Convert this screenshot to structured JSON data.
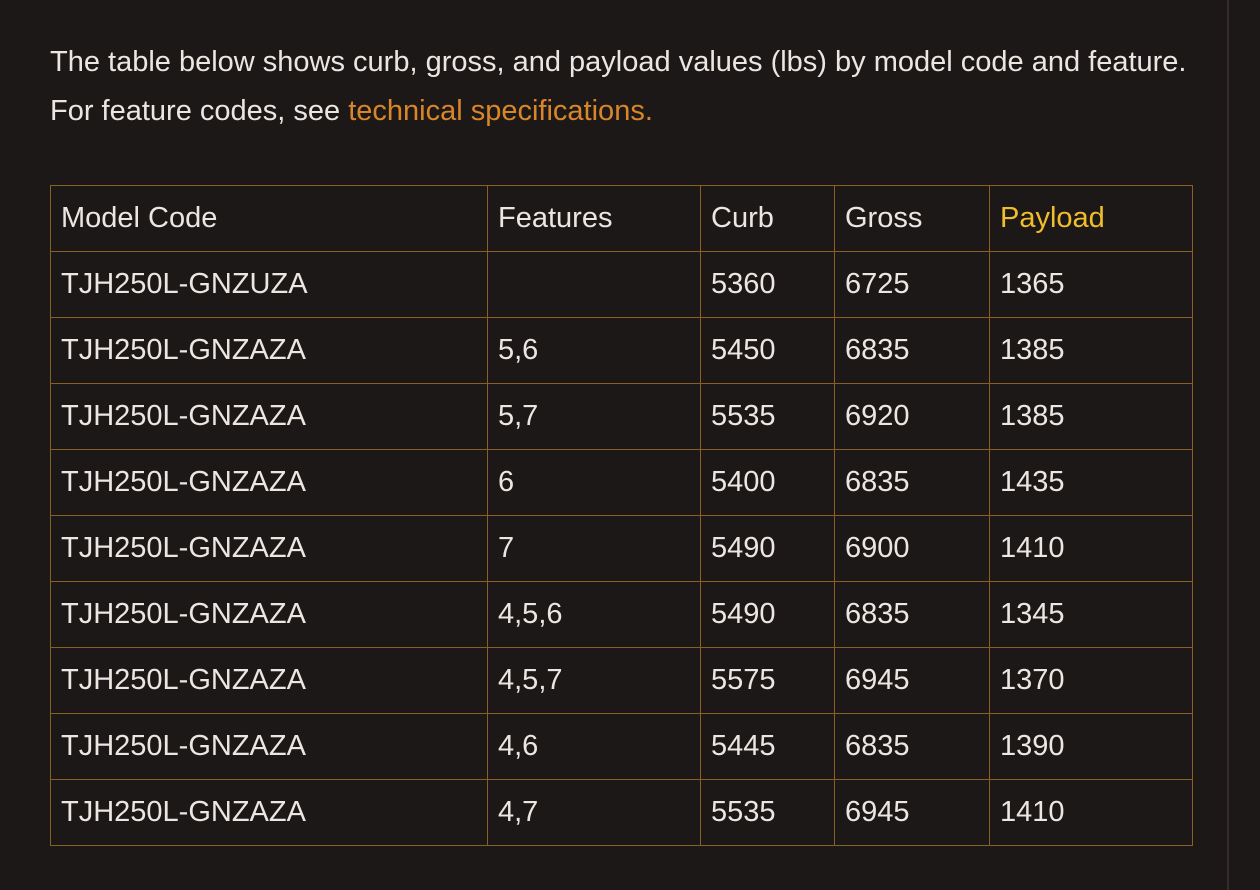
{
  "intro": {
    "text": "The table below shows curb, gross, and payload values (lbs) by model code and feature. For feature codes, see ",
    "link_text": "technical specifications."
  },
  "colors": {
    "background": "#1c1817",
    "text": "#ece6e2",
    "link": "#d9862a",
    "highlight_header": "#f2bd2b",
    "table_border": "#8a5f22"
  },
  "table": {
    "headers": {
      "model_code": "Model Code",
      "features": "Features",
      "curb": "Curb",
      "gross": "Gross",
      "payload": "Payload"
    },
    "rows": [
      {
        "model_code": "TJH250L-GNZUZA",
        "features": "",
        "curb": "5360",
        "gross": "6725",
        "payload": "1365"
      },
      {
        "model_code": "TJH250L-GNZAZA",
        "features": "5,6",
        "curb": "5450",
        "gross": "6835",
        "payload": "1385"
      },
      {
        "model_code": "TJH250L-GNZAZA",
        "features": "5,7",
        "curb": "5535",
        "gross": "6920",
        "payload": "1385"
      },
      {
        "model_code": "TJH250L-GNZAZA",
        "features": "6",
        "curb": "5400",
        "gross": "6835",
        "payload": "1435"
      },
      {
        "model_code": "TJH250L-GNZAZA",
        "features": "7",
        "curb": "5490",
        "gross": "6900",
        "payload": "1410"
      },
      {
        "model_code": "TJH250L-GNZAZA",
        "features": "4,5,6",
        "curb": "5490",
        "gross": "6835",
        "payload": "1345"
      },
      {
        "model_code": "TJH250L-GNZAZA",
        "features": "4,5,7",
        "curb": "5575",
        "gross": "6945",
        "payload": "1370"
      },
      {
        "model_code": "TJH250L-GNZAZA",
        "features": "4,6",
        "curb": "5445",
        "gross": "6835",
        "payload": "1390"
      },
      {
        "model_code": "TJH250L-GNZAZA",
        "features": "4,7",
        "curb": "5535",
        "gross": "6945",
        "payload": "1410"
      }
    ]
  }
}
